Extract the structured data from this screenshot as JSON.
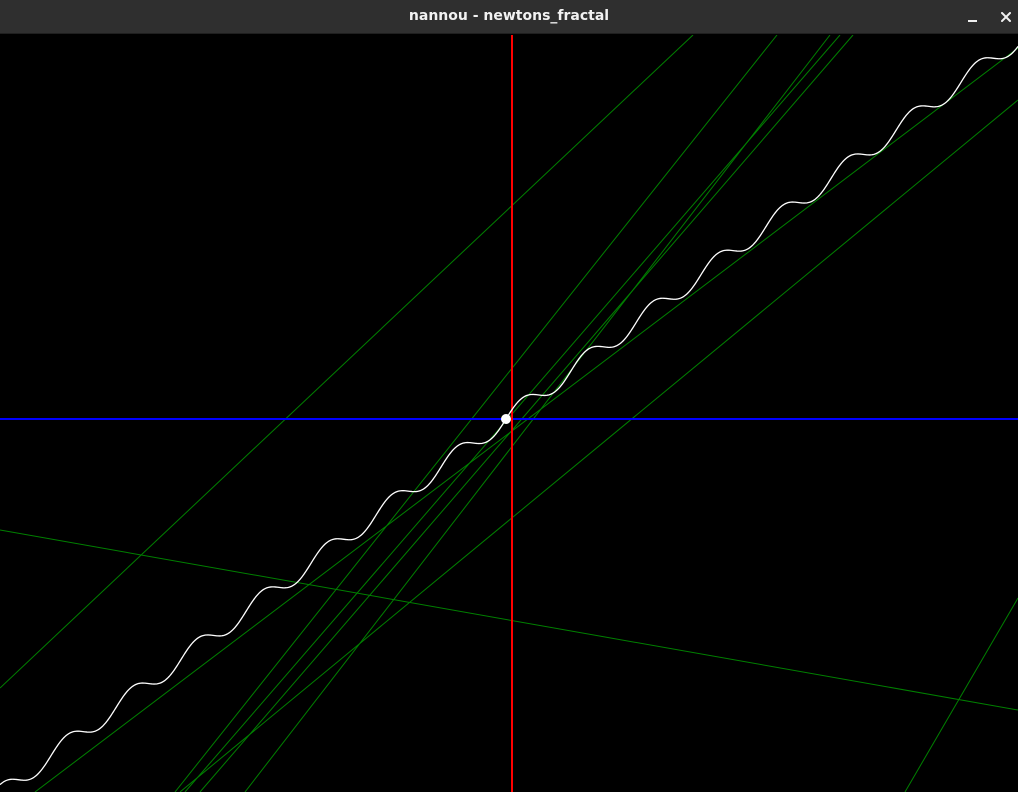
{
  "window": {
    "title": "nannou - newtons_fractal",
    "buttons": {
      "minimize_icon": "minimize-icon",
      "close_icon": "close-icon"
    }
  },
  "scene": {
    "background_color": "#000000",
    "x_axis_color": "#0000ff",
    "y_axis_color": "#ff0000",
    "tangent_line_color": "#008000",
    "curve_color": "#ffffff",
    "point_color": "#ffffff"
  }
}
